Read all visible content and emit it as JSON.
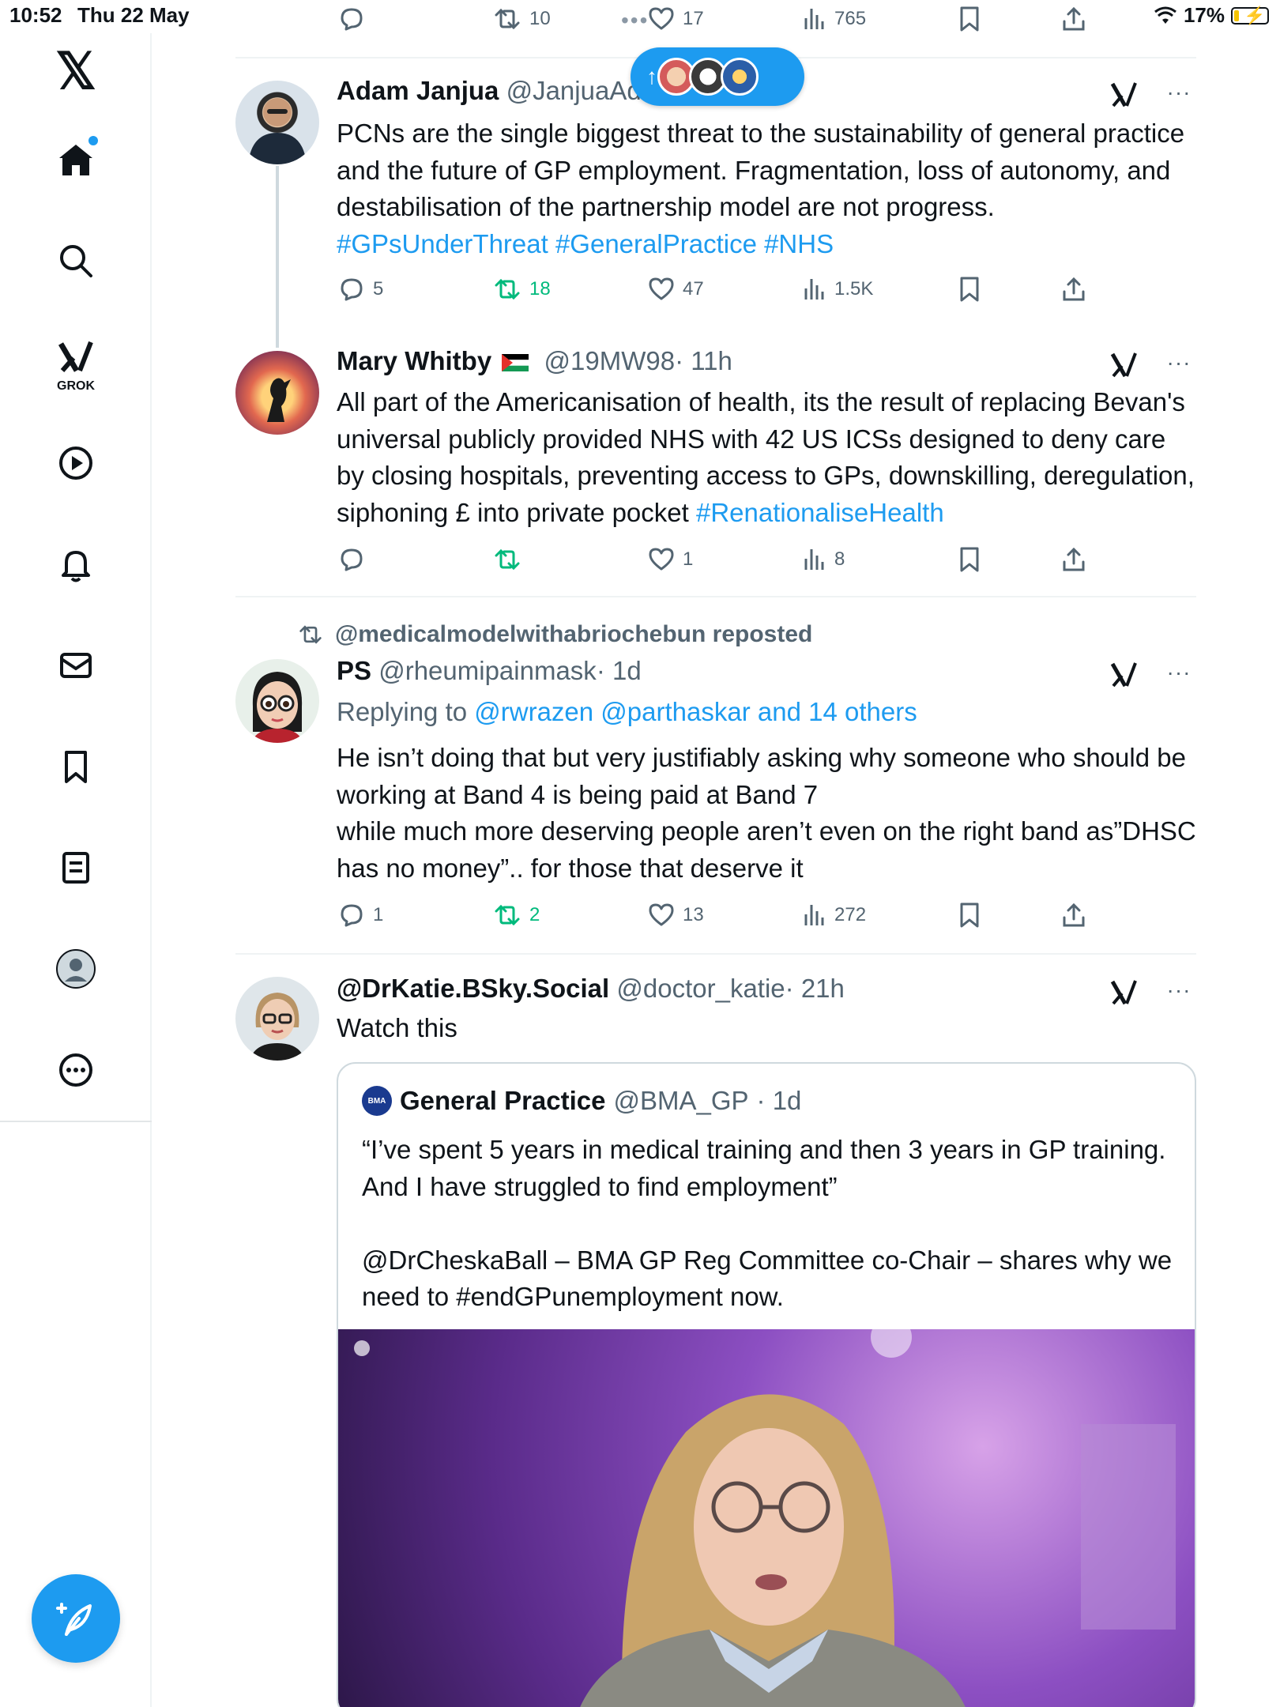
{
  "status_bar": {
    "time": "10:52",
    "date": "Thu 22 May",
    "battery": "17%"
  },
  "sidebar": {
    "grok_label": "GROK"
  },
  "top_actions": {
    "retweets": "10",
    "likes": "17",
    "views": "765"
  },
  "tweets": [
    {
      "name": "Adam Janjua",
      "handle": "@JanjuaAd",
      "text": "PCNs are the single biggest threat to the sustainability of general practice and the future of GP employment. Fragmentation, loss of autonomy, and destabilisation of the partnership model are not progress. ",
      "hashtags": "#GPsUnderThreat #GeneralPractice #NHS",
      "replies": "5",
      "retweets": "18",
      "likes": "47",
      "views": "1.5K"
    },
    {
      "name": "Mary Whitby",
      "handle": "@19MW98",
      "time": "· 11h",
      "text": "All part of the Americanisation of health, its the result of replacing Bevan's universal publicly provided NHS with 42 US ICSs designed to deny care by closing hospitals, preventing access to GPs, downskilling, deregulation,  siphoning £ into private pocket ",
      "hashtags": "#RenationaliseHealth",
      "replies": "",
      "retweets": "",
      "likes": "1",
      "views": "8"
    },
    {
      "repost_by": "@medicalmodelwithabriochebun reposted",
      "name": "PS",
      "handle": "@rheumipainmask",
      "time": "· 1d",
      "replying_prefix": "Replying to ",
      "replying_to": "@rwrazen @parthaskar and 14 others",
      "text_lines": [
        "He isn’t doing that but very justifiably asking why someone who should be working at Band 4 is being paid at Band 7",
        "while much more deserving people aren’t even on the right band as”DHSC has no money”.. for those that deserve it"
      ],
      "replies": "1",
      "retweets": "2",
      "likes": "13",
      "views": "272"
    },
    {
      "name": "@DrKatie.BSky.Social",
      "handle": "@doctor_katie",
      "time": "· 21h",
      "text": "Watch this",
      "quote": {
        "logo_text": "BMA",
        "name": "General Practice",
        "handle": "@BMA_GP",
        "time": "· 1d",
        "paragraph1": "“I’ve spent 5 years in medical training and then 3 years in GP training. And I have struggled to find employment”",
        "paragraph2": "@DrCheskaBall – BMA GP Reg Committee co-Chair – shares why we need to #endGPunemployment now."
      }
    }
  ],
  "colors": {
    "accent": "#1d9bf0",
    "retweet_green": "#00ba7c",
    "muted": "#536471",
    "text": "#0f1419"
  },
  "icons": [
    "x-logo",
    "home-icon",
    "search-icon",
    "grok-icon",
    "video-icon",
    "bell-icon",
    "mail-icon",
    "bookmark-icon",
    "list-icon",
    "profile-icon",
    "more-icon",
    "compose-icon",
    "reply-icon",
    "retweet-icon",
    "like-icon",
    "views-icon",
    "share-icon"
  ]
}
